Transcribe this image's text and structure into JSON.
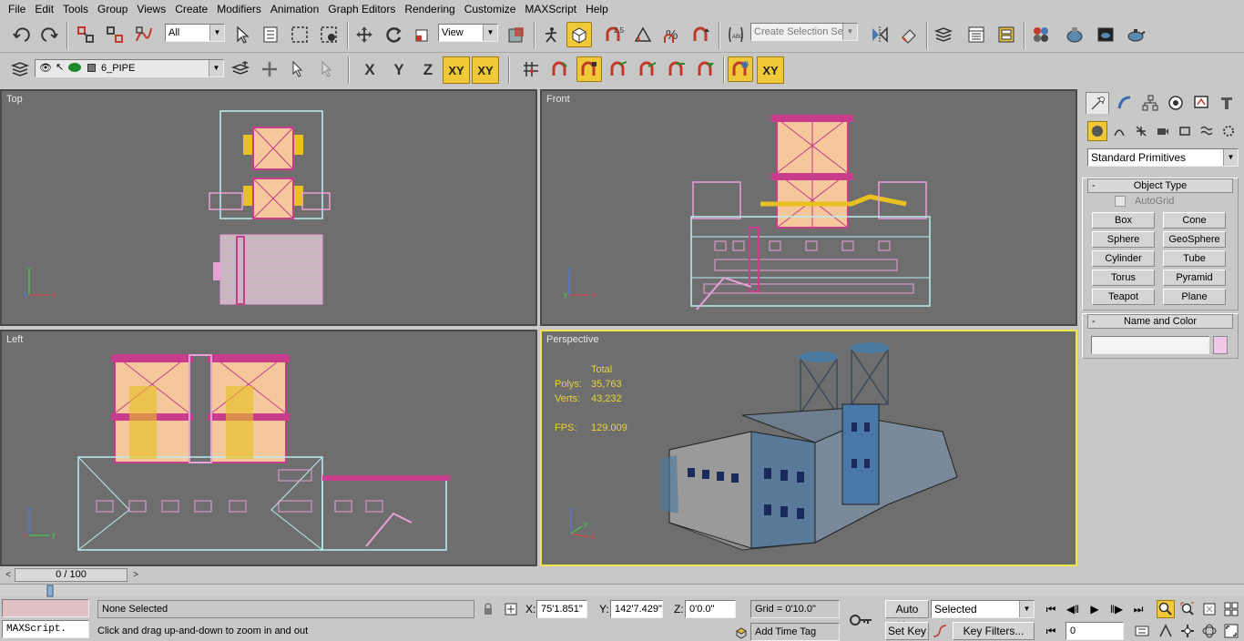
{
  "menu": [
    "File",
    "Edit",
    "Tools",
    "Group",
    "Views",
    "Create",
    "Modifiers",
    "Animation",
    "Graph Editors",
    "Rendering",
    "Customize",
    "MAXScript",
    "Help"
  ],
  "toolbar": {
    "selection_filter": "All",
    "ref_coord": "View",
    "named_selection_placeholder": "Create Selection Set",
    "snap_label": "2.5"
  },
  "layer_bar": {
    "current_layer": "6_PIPE"
  },
  "axis_constraints": {
    "x": "X",
    "y": "Y",
    "z": "Z",
    "xy": "XY",
    "xy2": "XY",
    "xy_snap": "XY"
  },
  "viewports": {
    "top": {
      "label": "Top"
    },
    "front": {
      "label": "Front"
    },
    "left": {
      "label": "Left"
    },
    "perspective": {
      "label": "Perspective",
      "stats_header": "Total",
      "polys_label": "Polys:",
      "polys_value": "35,763",
      "verts_label": "Verts:",
      "verts_value": "43,232",
      "fps_label": "FPS:",
      "fps_value": "129.009"
    }
  },
  "command_panel": {
    "category": "Standard Primitives",
    "object_type_title": "Object Type",
    "autogrid_label": "AutoGrid",
    "primitives": [
      "Box",
      "Cone",
      "Sphere",
      "GeoSphere",
      "Cylinder",
      "Tube",
      "Torus",
      "Pyramid",
      "Teapot",
      "Plane"
    ],
    "name_color_title": "Name and Color",
    "name_value": "",
    "object_color": "#f2c7e6"
  },
  "timeline": {
    "slider_label": "0 / 100"
  },
  "status": {
    "maxscript_listener": "MAXScript.",
    "selection_status": "None Selected",
    "prompt": "Click and drag up-and-down to zoom in and out",
    "x_label": "X:",
    "x_value": "75'1.851\"",
    "y_label": "Y:",
    "y_value": "142'7.429\"",
    "z_label": "Z:",
    "z_value": "0'0.0\"",
    "grid": "Grid = 0'10.0\"",
    "add_time_tag": "Add Time Tag",
    "auto_key": "Auto Key",
    "set_key": "Set Key",
    "key_mode": "Selected",
    "key_filters": "Key Filters...",
    "current_frame": "0"
  },
  "colors": {
    "accent": "#f0c93a",
    "viewport_bg": "#6e6e6e",
    "active_viewport_border": "#f4e44a",
    "wire_cyan": "#b8f0f0",
    "wire_magenta": "#c83c8c",
    "wire_pink": "#e8a0d8",
    "wire_yellow": "#e8c020",
    "stats_text": "#e8d43a"
  }
}
